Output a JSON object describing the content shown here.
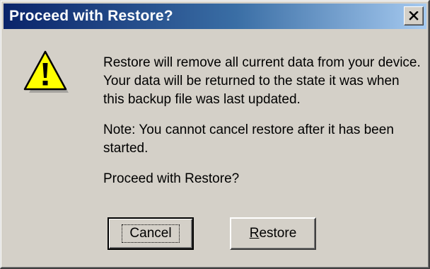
{
  "dialog": {
    "title": "Proceed with Restore?",
    "close_glyph": "×",
    "icon": "warning-triangle-exclamation-icon",
    "message": {
      "paragraph1": "Restore will remove all current data from your device. Your data will be returned to the state it was when this backup file was last updated.",
      "paragraph2": "Note: You cannot cancel restore after it has been started.",
      "paragraph3": "Proceed with Restore?"
    },
    "buttons": {
      "cancel_label": "Cancel",
      "restore_mnemonic": "R",
      "restore_label_rest": "estore"
    }
  },
  "colors": {
    "titlebar_start": "#0a246a",
    "titlebar_end": "#a6caf0",
    "face": "#d4d0c8",
    "warning_yellow": "#ffff00"
  }
}
